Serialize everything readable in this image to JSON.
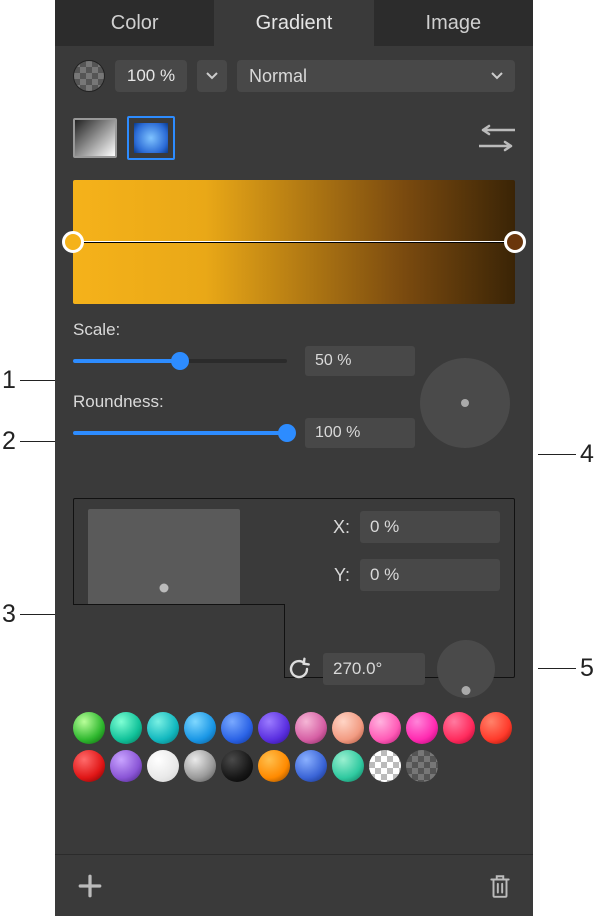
{
  "tabs": {
    "color": "Color",
    "gradient": "Gradient",
    "image": "Image",
    "active": "gradient"
  },
  "opacity": {
    "value": "100 %"
  },
  "blend_mode": {
    "label": "Normal"
  },
  "gradient": {
    "stops": [
      {
        "pos": 0,
        "color": "#f5b21a"
      },
      {
        "pos": 100,
        "color": "#6a360b"
      }
    ]
  },
  "scale": {
    "label": "Scale:",
    "value": "50 %",
    "pct": 50
  },
  "roundness": {
    "label": "Roundness:",
    "value": "100 %",
    "pct": 100
  },
  "position": {
    "x": {
      "label": "X:",
      "value": "0 %"
    },
    "y": {
      "label": "Y:",
      "value": "0 %"
    }
  },
  "angle": {
    "value": "270.0°",
    "deg": 270
  },
  "presets_row1": [
    "radial-gradient(circle at 35% 30%, #b9ff9a, #2fb82f 60%, #0a5a0a)",
    "radial-gradient(circle at 35% 30%, #7fffd4, #11c29a 60%, #066b52)",
    "radial-gradient(circle at 35% 30%, #79f0e3, #12b8bf 60%, #066d70)",
    "radial-gradient(circle at 35% 30%, #7fd8ff, #1a97e6 60%, #08548a)",
    "radial-gradient(circle at 35% 30%, #79a9ff, #2b63e6 60%, #0c2f8a)",
    "radial-gradient(circle at 35% 30%, #9b7bff, #5a2fe0 60%, #2a0f85)",
    "radial-gradient(circle at 35% 30%, #f5b6d6, #d65fa4 60%, #7a1f55)",
    "radial-gradient(circle at 35% 30%, #ffd5c6, #f29b82 60%, #a14a33)",
    "radial-gradient(circle at 35% 30%, #ffb3df, #ff5ab6 60%, #a9116c)",
    "radial-gradient(circle at 35% 30%, #ff84d9, #ff2ab0 60%, #a3006a)",
    "radial-gradient(circle at 35% 30%, #ff7aa0, #ff2b5d 60%, #a3002c)",
    "radial-gradient(circle at 35% 30%, #ff826a, #ff3a2b 60%, #8a0e00)"
  ],
  "presets_row2": [
    "radial-gradient(circle at 35% 30%, #ff6b6b, #e01616 60%, #6a0000)",
    "radial-gradient(circle at 35% 30%, #c9a4ff, #8a55d6 60%, #3f1d73)",
    "radial-gradient(circle at 35% 30%, #ffffff, #e9e9e9 60%, #cfcfcf)",
    "radial-gradient(circle at 35% 30%, #eaeaea, #9a9a9a 60%, #4b4b4b)",
    "radial-gradient(circle at 35% 30%, #4a4a4a, #171717 60%, #000)",
    "radial-gradient(circle at 35% 30%, #ffbf4d, #ff8a00 60%, #7a3d00)",
    "radial-gradient(circle at 35% 30%, #8ab0ff, #3a64d6 60%, #122a73)",
    "radial-gradient(circle at 35% 30%, #9af0d0, #2fc9a0 60%, #0d6a50)",
    "conic-gradient(#fff 0 25%, #bbb 0 50%, #fff 0 75%, #bbb 0)",
    "conic-gradient(#555 0 25%, #777 0 50%, #555 0 75%, #777 0)"
  ],
  "callouts": {
    "c1": "1",
    "c2": "2",
    "c3": "3",
    "c4": "4",
    "c5": "5"
  }
}
